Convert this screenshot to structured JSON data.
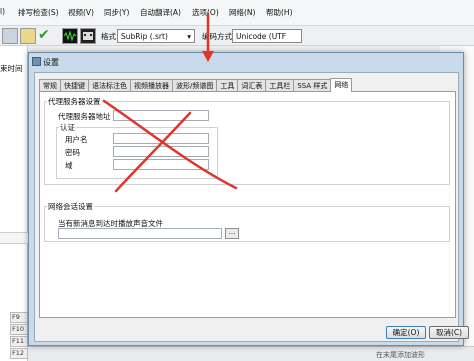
{
  "menubar": {
    "items": [
      "排写检查(S)",
      "视频(V)",
      "同步(Y)",
      "自动翻译(A)",
      "选项(O)",
      "网络(N)",
      "帮助(H)"
    ],
    "left_fragment": "l)"
  },
  "toolbar": {
    "format_label": "格式",
    "format_value": "SubRip (.srt)",
    "encoding_label": "编码方式",
    "encoding_value": "Unicode (UTF"
  },
  "left_panel": {
    "time_text": "束时间",
    "function_keys": [
      "F9",
      "F10",
      "F11",
      "F12"
    ]
  },
  "status_text": "在末尾添加波形",
  "dialog": {
    "title": "设置",
    "tabs": [
      "常规",
      "快捷键",
      "语法标注色",
      "视频播放器",
      "波形/频谱图",
      "工具",
      "词汇表",
      "工具栏",
      "SSA 样式",
      "网络"
    ],
    "active_tab_index": 9,
    "proxy_group": {
      "title": "代理服务器设置",
      "address_label": "代理服务器地址",
      "auth_title": "认证",
      "username_label": "用户名",
      "password_label": "密码",
      "domain_label": "域"
    },
    "session_group": {
      "title": "网络会话设置",
      "sound_label": "当有新消息到达时播放声音文件",
      "browse_label": "..."
    },
    "ok_label": "确定(O)",
    "cancel_label": "取消(C)"
  },
  "annotation": {
    "color": "#e0342a"
  }
}
